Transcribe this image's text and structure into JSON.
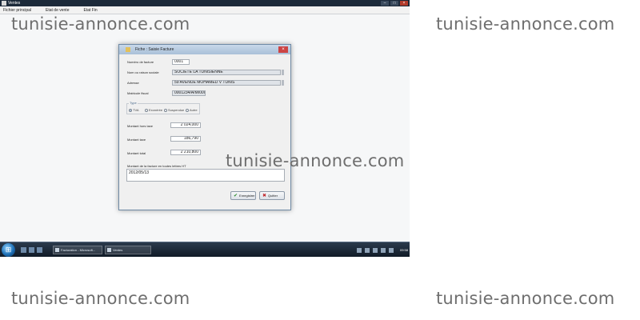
{
  "app": {
    "title": "Ventes",
    "menu": [
      "Fichier principal",
      "Etat de vente",
      "Etat Fin"
    ]
  },
  "dialog": {
    "title": "Fiche : Saisie Facture",
    "fields": [
      {
        "label": "Numéro de facture",
        "value": "0001"
      },
      {
        "label": "Nom ou raison sociale",
        "value": "SOCIETE LA TUNISIENNE"
      },
      {
        "label": "Adresse",
        "value": "59 AVENUE MOHAMED V TUNIS"
      },
      {
        "label": "Matricule fiscal",
        "value": "0001234/A/M/000"
      }
    ],
    "group": {
      "title": "Type",
      "options": [
        {
          "label": "TVA",
          "selected": true
        },
        {
          "label": "Exonérée",
          "selected": false
        },
        {
          "label": "Suspendue",
          "selected": false
        },
        {
          "label": "Autre",
          "selected": false
        }
      ]
    },
    "amounts": [
      {
        "label": "Montant hors taxe",
        "value": "2 024,000"
      },
      {
        "label": "Montant taxe",
        "value": "186,790"
      },
      {
        "label": "Montant total",
        "value": "2 210,800"
      }
    ],
    "memo_label": "Montant de la facture en toutes lettres HT",
    "memo_value": "2012/05/13",
    "buttons": {
      "ok": "Enregistrer",
      "cancel": "Quitter"
    }
  },
  "taskbar": {
    "tasks": [
      "Facturation - Microsoft...",
      "Ventes"
    ],
    "clock": "09:58"
  },
  "watermark": {
    "text": "tunisie-annonce.com"
  }
}
